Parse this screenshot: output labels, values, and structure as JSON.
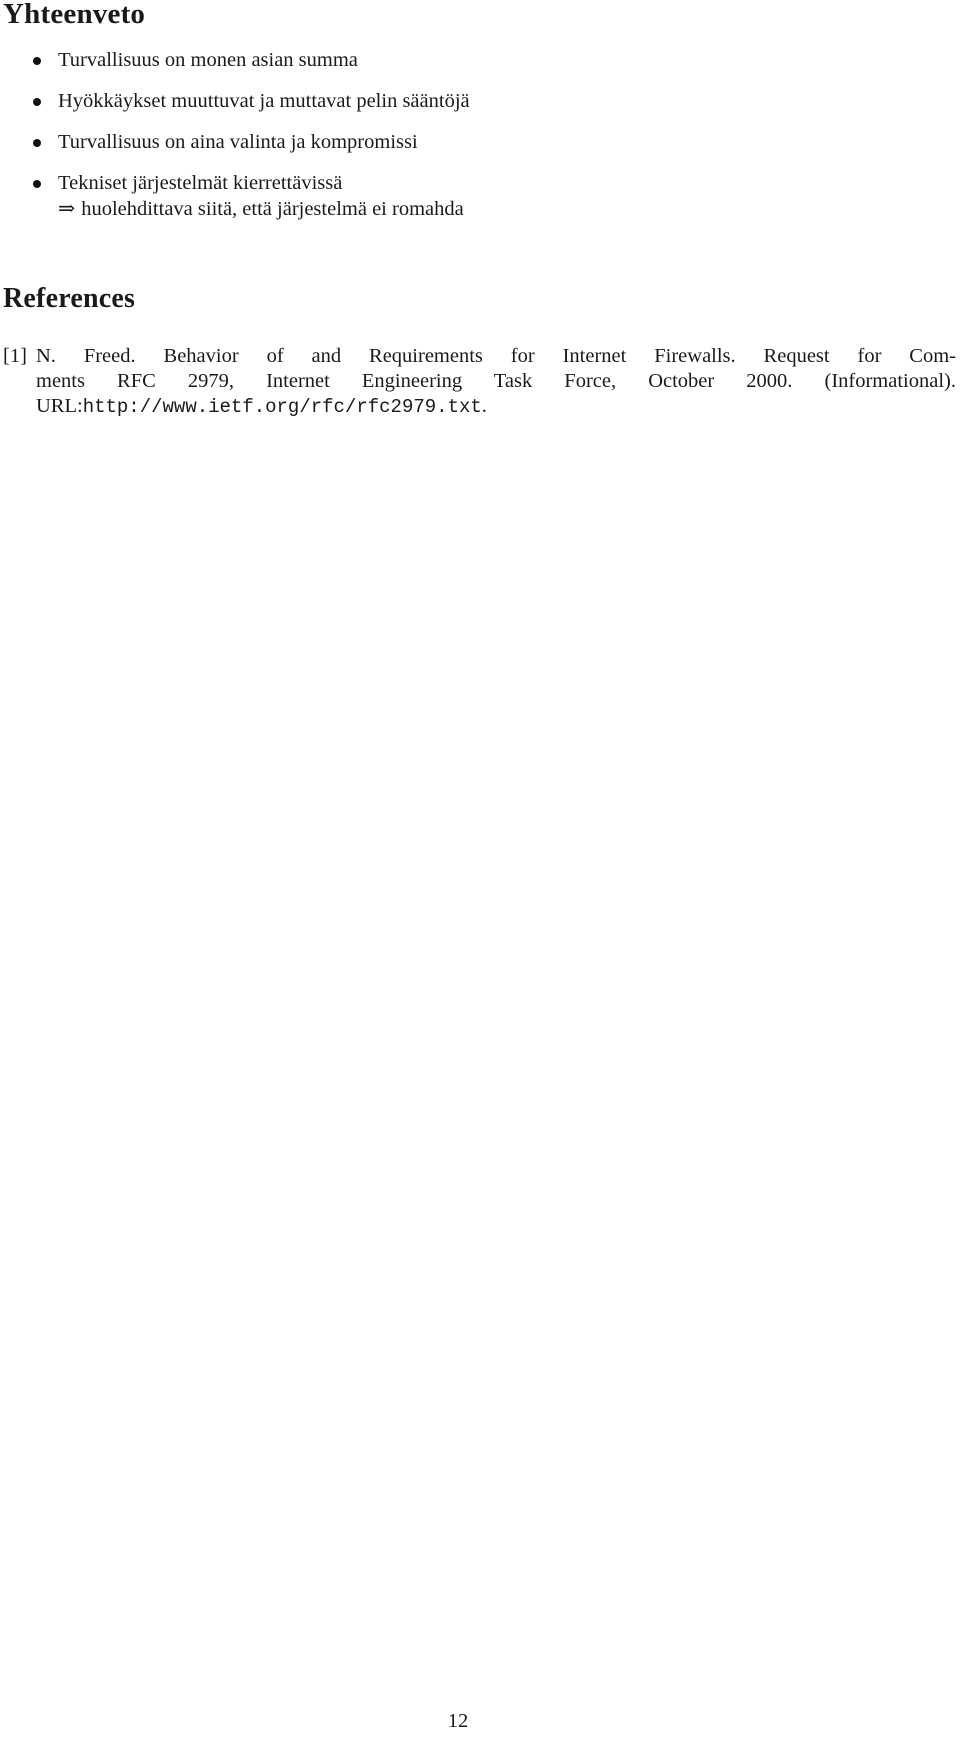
{
  "summary": {
    "title": "Yhteenveto",
    "bullets": [
      {
        "text": "Turvallisuus on monen asian summa"
      },
      {
        "text": "Hyökkäykset muuttuvat ja muttavat pelin sääntöjä"
      },
      {
        "text": "Turvallisuus on aina valinta ja kompromissi"
      },
      {
        "text": "Tekniset järjestelmät kierrettävissä",
        "sub_arrow": "⇒",
        "sub_text": "huolehdittava siitä, että järjestelmä ei romahda"
      }
    ]
  },
  "references": {
    "title": "References",
    "items": [
      {
        "label": "[1]",
        "lines": [
          "N. Freed.  Behavior of and Requirements for Internet Firewalls.  Request for Com-",
          "ments RFC 2979, Internet Engineering Task Force, October 2000.  (Informational)."
        ],
        "url_prefix": "URL:",
        "url": "http://www.ietf.org/rfc/rfc2979.txt",
        "url_suffix": "."
      }
    ]
  },
  "footer": {
    "page_number": "12"
  }
}
